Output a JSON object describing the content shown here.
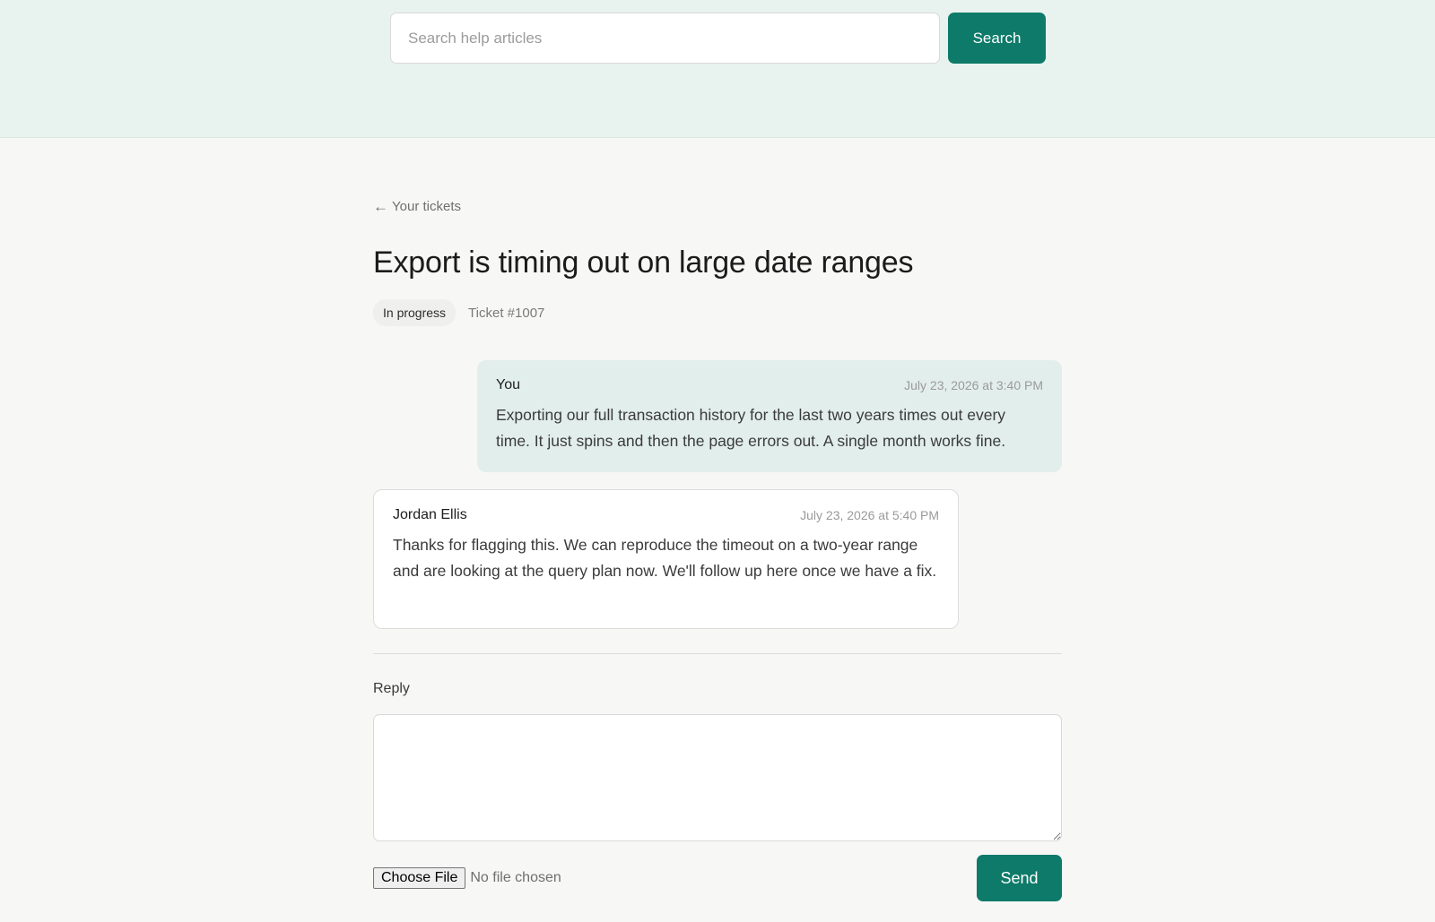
{
  "search": {
    "placeholder": "Search help articles",
    "button_label": "Search"
  },
  "back_link": {
    "arrow": "←",
    "label": "Your tickets"
  },
  "ticket": {
    "title": "Export is timing out on large date ranges",
    "status": "In progress",
    "number": "Ticket #1007"
  },
  "messages": [
    {
      "author": "You",
      "time": "July 23, 2026 at 3:40 PM",
      "body": "Exporting our full transaction history for the last two years times out every time. It just spins and then the page errors out. A single month works fine."
    },
    {
      "author": "Jordan Ellis",
      "time": "July 23, 2026 at 5:40 PM",
      "body": "Thanks for flagging this. We can reproduce the timeout on a two-year range and are looking at the query plan now. We'll follow up here once we have a fix."
    }
  ],
  "reply": {
    "label": "Reply",
    "value": "",
    "choose_file_label": "Choose File",
    "file_status": "No file chosen",
    "send_label": "Send"
  },
  "colors": {
    "accent": "#0e7a69",
    "header_background": "#e8f2ef",
    "own_message_background": "#e2eeeb"
  }
}
